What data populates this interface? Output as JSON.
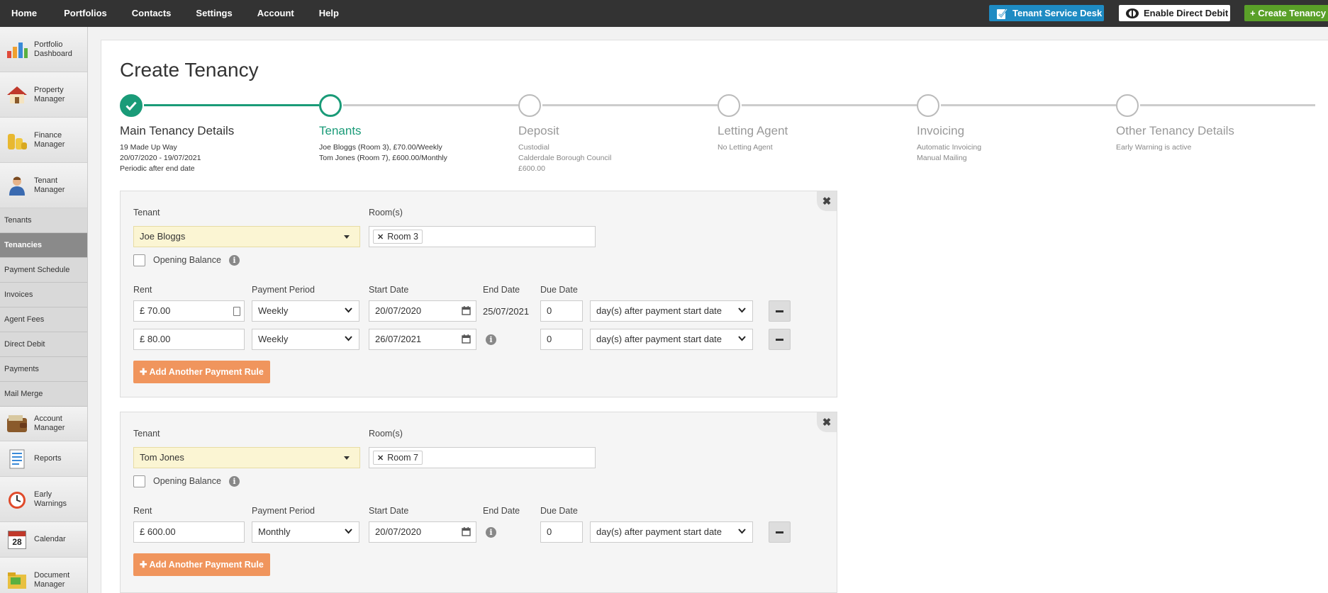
{
  "topnav": [
    "Home",
    "Portfolios",
    "Contacts",
    "Settings",
    "Account",
    "Help"
  ],
  "top_buttons": {
    "service_desk": "Tenant Service Desk",
    "direct_debit": "Enable Direct Debit",
    "create_tenancy": "+ Create Tenancy"
  },
  "sidebar": {
    "portfolio_dashboard": "Portfolio Dashboard",
    "property_manager": "Property Manager",
    "finance_manager": "Finance Manager",
    "tenant_manager": "Tenant Manager",
    "subitems": [
      "Tenants",
      "Tenancies",
      "Payment Schedule",
      "Invoices",
      "Agent Fees",
      "Direct Debit",
      "Payments",
      "Mail Merge"
    ],
    "active_subitem": "Tenancies",
    "account_manager": "Account Manager",
    "reports": "Reports",
    "early_warnings": "Early Warnings",
    "calendar": "Calendar",
    "document_manager": "Document Manager",
    "calendar_day": "28"
  },
  "page": {
    "title": "Create Tenancy"
  },
  "steps": [
    {
      "title": "Main Tenancy Details",
      "lines": [
        "19 Made Up Way",
        "20/07/2020 - 19/07/2021",
        "Periodic after end date"
      ]
    },
    {
      "title": "Tenants",
      "lines": [
        "Joe Bloggs (Room 3), £70.00/Weekly",
        "Tom Jones (Room 7), £600.00/Monthly"
      ]
    },
    {
      "title": "Deposit",
      "lines": [
        "Custodial",
        "Calderdale Borough Council",
        "£600.00"
      ]
    },
    {
      "title": "Letting Agent",
      "lines": [
        "No Letting Agent"
      ]
    },
    {
      "title": "Invoicing",
      "lines": [
        "Automatic Invoicing",
        "Manual Mailing"
      ]
    },
    {
      "title": "Other Tenancy Details",
      "lines": [
        "Early Warning is active"
      ]
    }
  ],
  "labels": {
    "tenant": "Tenant",
    "rooms": "Room(s)",
    "opening_balance": "Opening Balance",
    "rent": "Rent",
    "payment_period": "Payment Period",
    "start_date": "Start Date",
    "end_date": "End Date",
    "due_date": "Due Date",
    "add_rule": "Add Another Payment Rule",
    "currency": "£"
  },
  "tenants": [
    {
      "name": "Joe Bloggs",
      "room": "Room 3",
      "rules": [
        {
          "rent": "70.00",
          "period": "Weekly",
          "start": "20/07/2020",
          "end": "25/07/2021",
          "due": "0",
          "due_type": "day(s) after payment start date"
        },
        {
          "rent": "80.00",
          "period": "Weekly",
          "start": "26/07/2021",
          "end": "",
          "due": "0",
          "due_type": "day(s) after payment start date"
        }
      ]
    },
    {
      "name": "Tom Jones",
      "room": "Room 7",
      "rules": [
        {
          "rent": "600.00",
          "period": "Monthly",
          "start": "20/07/2020",
          "end": "",
          "due": "0",
          "due_type": "day(s) after payment start date"
        }
      ]
    }
  ],
  "colors": {
    "accent": "#1a9b78",
    "topbar": "#333333",
    "service_desk": "#1e8bc3",
    "create": "#5aa028",
    "add_rule": "#f0955d",
    "tenant_select": "#fbf5d3"
  }
}
